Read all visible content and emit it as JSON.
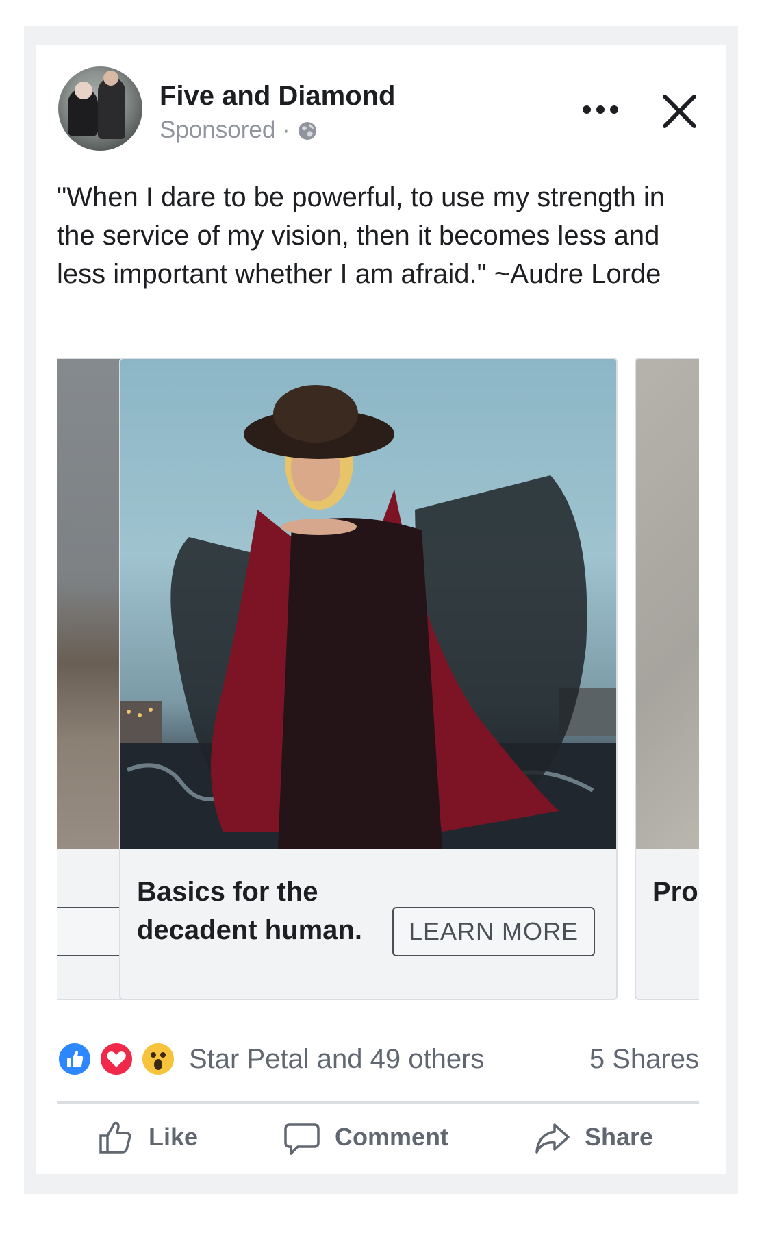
{
  "post": {
    "page_name": "Five and Diamond",
    "sponsored_label": "Sponsored ·",
    "text": "\"When I dare to be powerful, to use my strength in the service of my vision, then it becomes less and less important whether I am afraid.\" ~Audre Lorde",
    "icons": {
      "more": "more-dots-icon",
      "close": "close-icon",
      "audience": "globe-icon"
    }
  },
  "carousel": {
    "prev": {
      "cta": ""
    },
    "main": {
      "headline": "Basics for the decadent human.",
      "cta": "LEARN MORE"
    },
    "next": {
      "headline": "Pro sm"
    }
  },
  "reactions": {
    "types": [
      "like",
      "love",
      "wow"
    ],
    "names": "Star Petal and 49 others",
    "shares": "5 Shares"
  },
  "actions": {
    "like": "Like",
    "comment": "Comment",
    "share": "Share"
  },
  "colors": {
    "text": "#1c1e21",
    "secondary": "#606770",
    "like_blue": "#2d88ff",
    "love_red": "#f0284a",
    "wow_yellow": "#f7c33c"
  }
}
